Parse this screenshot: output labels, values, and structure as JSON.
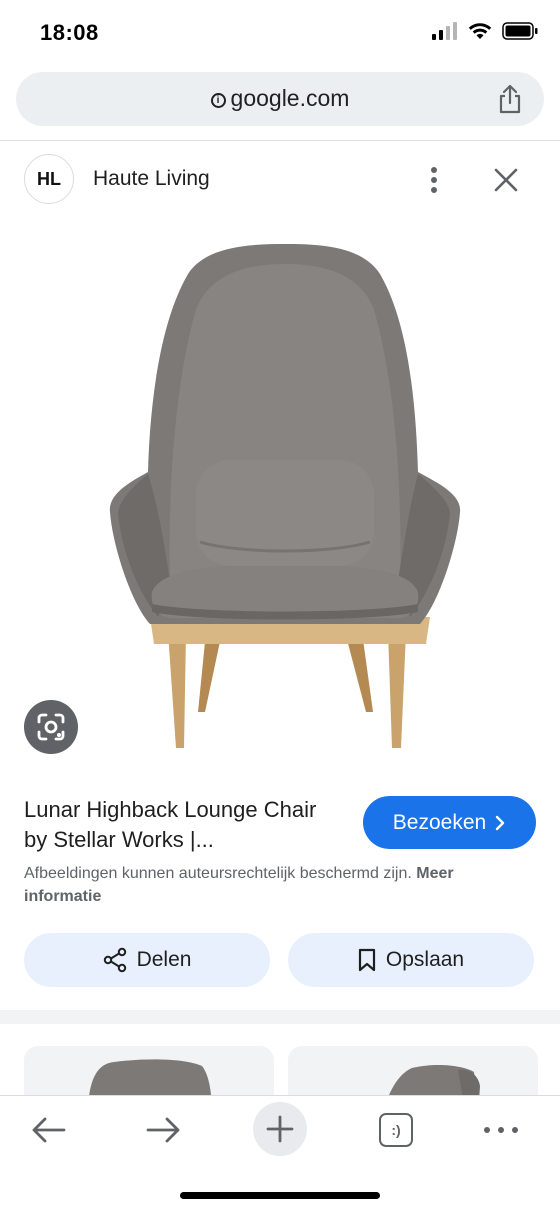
{
  "status_bar": {
    "time": "18:08"
  },
  "browser": {
    "url": "google.com"
  },
  "source": {
    "avatar_initials": "HL",
    "name": "Haute Living"
  },
  "result": {
    "title": "Lunar Highback Lounge Chair by Stellar Works |...",
    "visit_label": "Bezoeken",
    "copyright_text": "Afbeeldingen kunnen auteursrechtelijk beschermd zijn.",
    "copyright_link": "Meer informatie"
  },
  "actions": {
    "share_label": "Delen",
    "save_label": "Opslaan"
  },
  "toolbar": {
    "tabs_label": ":)"
  },
  "icons": {
    "info": "info-icon",
    "share": "share-icon",
    "more": "more-vertical-icon",
    "close": "close-icon",
    "lens": "lens-icon",
    "chevron": "chevron-right-icon",
    "share_nodes": "share-nodes-icon",
    "bookmark": "bookmark-icon",
    "back": "arrow-back-icon",
    "forward": "arrow-forward-icon",
    "new_tab": "plus-icon",
    "tabs": "tabs-icon",
    "overflow": "more-horizontal-icon"
  },
  "colors": {
    "accent": "#1a73e8",
    "chip_bg": "#e8f0fe",
    "url_bar_bg": "#eceff1",
    "chair_fabric": "#7d7977",
    "chair_wood": "#c9a36b"
  }
}
